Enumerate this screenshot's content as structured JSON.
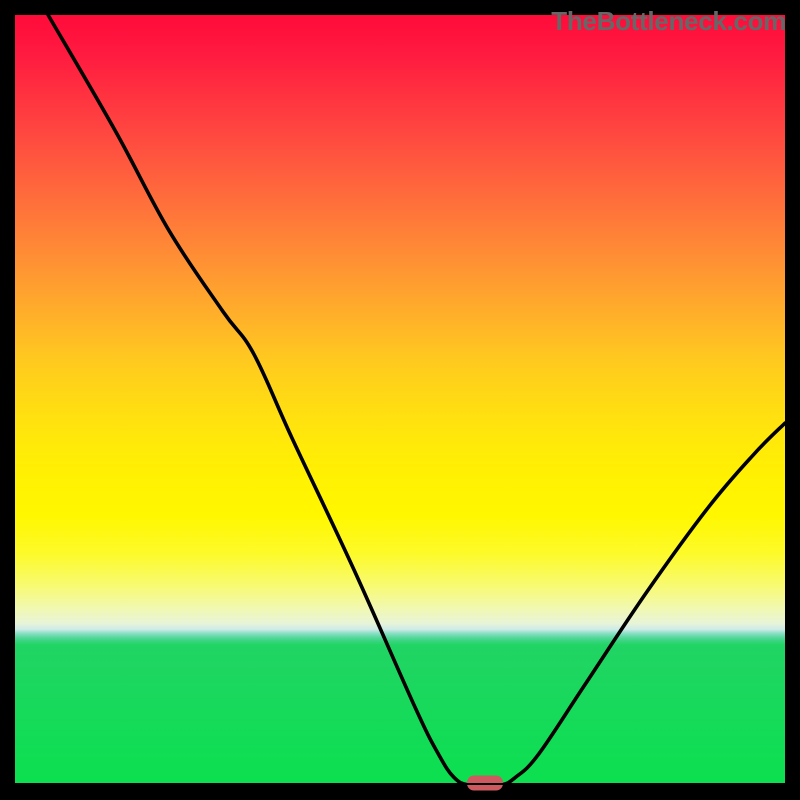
{
  "watermark": "TheBottleneck.com",
  "chart_data": {
    "type": "line",
    "title": "",
    "xlabel": "",
    "ylabel": "",
    "xlim": [
      0,
      100
    ],
    "ylim": [
      0,
      100
    ],
    "curve": [
      {
        "x": 4.3,
        "y": 100
      },
      {
        "x": 13,
        "y": 85
      },
      {
        "x": 20,
        "y": 72
      },
      {
        "x": 27,
        "y": 61.5
      },
      {
        "x": 31,
        "y": 56
      },
      {
        "x": 36,
        "y": 45
      },
      {
        "x": 44,
        "y": 28
      },
      {
        "x": 52,
        "y": 10
      },
      {
        "x": 55,
        "y": 4
      },
      {
        "x": 57,
        "y": 1
      },
      {
        "x": 59,
        "y": 0
      },
      {
        "x": 63,
        "y": 0
      },
      {
        "x": 65,
        "y": 1
      },
      {
        "x": 68,
        "y": 4
      },
      {
        "x": 74,
        "y": 13
      },
      {
        "x": 82,
        "y": 25
      },
      {
        "x": 90,
        "y": 36
      },
      {
        "x": 96,
        "y": 43
      },
      {
        "x": 100,
        "y": 47
      }
    ],
    "minimum_marker": {
      "x": 61,
      "y": 0
    },
    "gradient_stops": [
      {
        "pos": 0,
        "color": "#ff0b3a"
      },
      {
        "pos": 50,
        "color": "#ffda14"
      },
      {
        "pos": 78,
        "color": "#f1f8b0"
      },
      {
        "pos": 81,
        "color": "#21d464"
      },
      {
        "pos": 100,
        "color": "#0be04f"
      }
    ]
  }
}
